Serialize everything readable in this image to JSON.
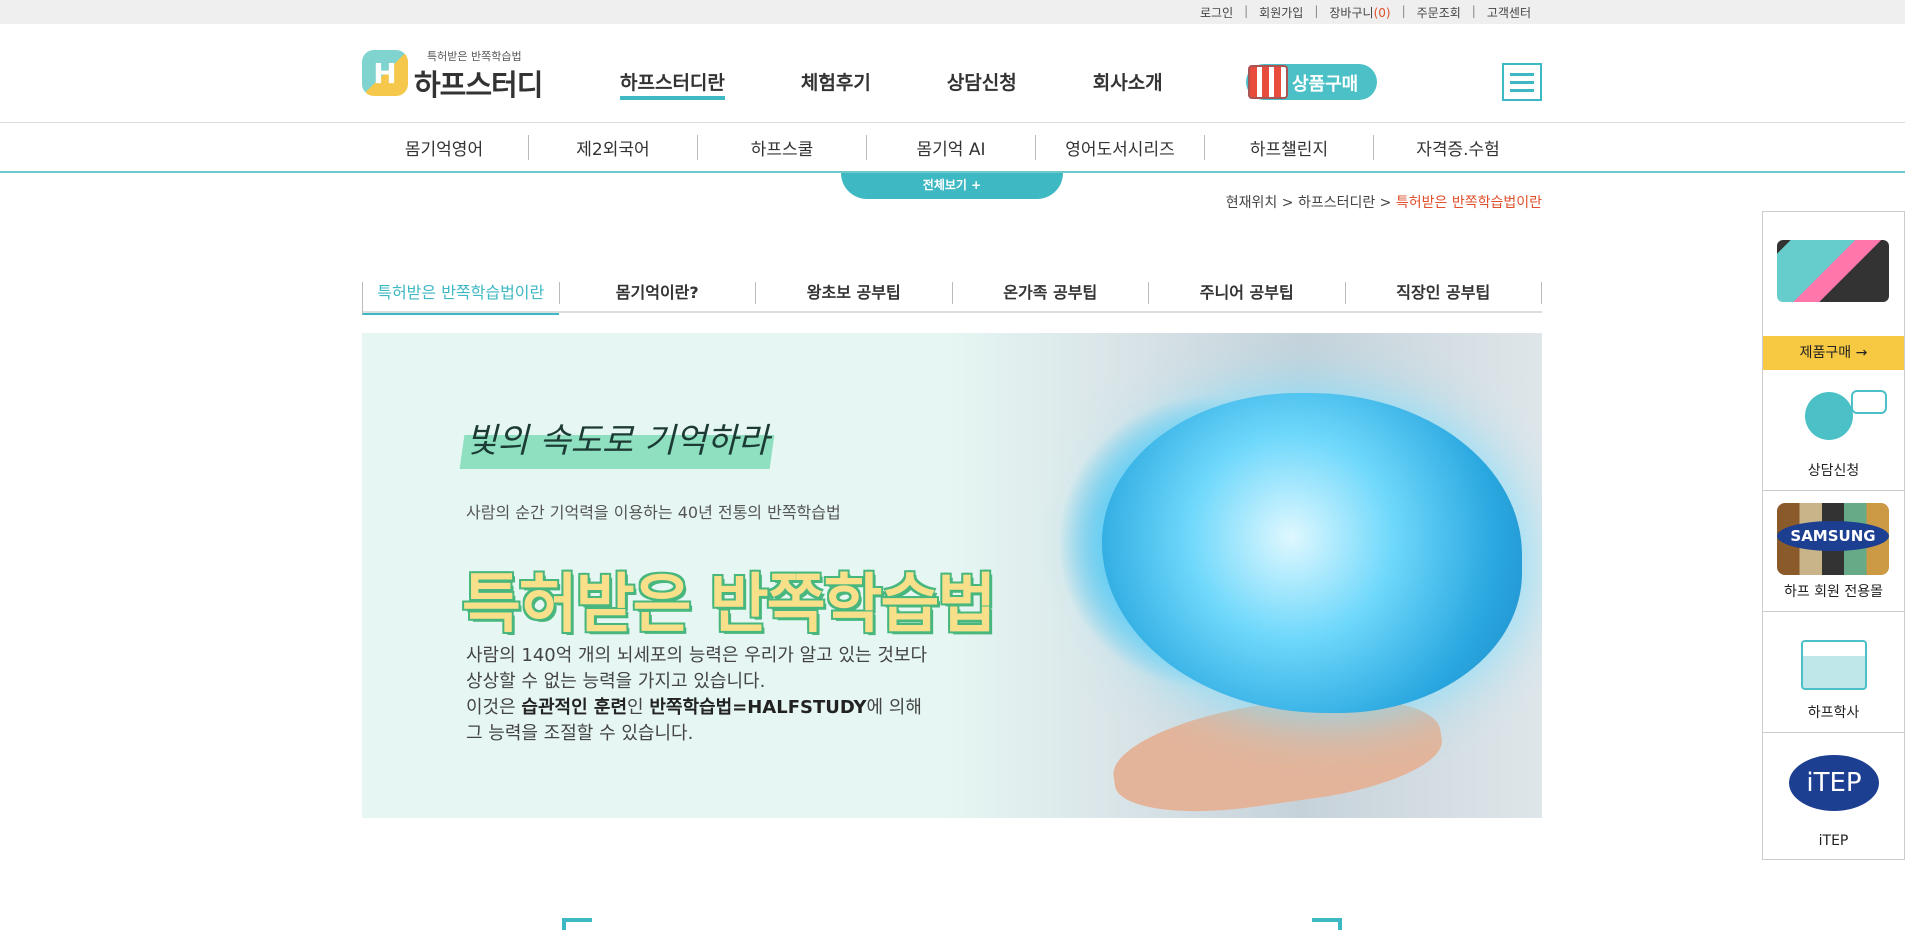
{
  "top_links": {
    "login": "로그인",
    "join": "회원가입",
    "cart": "장바구니",
    "cart_count": "(0)",
    "order": "주문조회",
    "cs": "고객센터"
  },
  "logo": {
    "sub": "특허받은 반쪽학습법",
    "main": "하프스터디"
  },
  "gnb": [
    "하프스터디란",
    "체험후기",
    "상담신청",
    "회사소개"
  ],
  "buy_button": "상품구매",
  "subnav": [
    "몸기억영어",
    "제2외국어",
    "하프스쿨",
    "몸기억 AI",
    "영어도서시리즈",
    "하프챌린지",
    "자격증.수험"
  ],
  "view_all": "전체보기 +",
  "location": {
    "prefix": "현재위치 > 하프스터디란 > ",
    "current": "특허받은 반쪽학습법이란"
  },
  "tabs": [
    "특허받은 반쪽학습법이란",
    "몸기억이란?",
    "왕초보 공부팁",
    "온가족 공부팁",
    "주니어 공부팁",
    "직장인 공부팁"
  ],
  "hero": {
    "script": "빛의 속도로 기억하라",
    "subtitle": "사람의 순간 기억력을 이용하는 40년 전통의 반쪽학습법",
    "title": "특허받은 반쪽학습법",
    "desc_line1": "사람의 140억 개의 뇌세포의 능력은 우리가 알고 있는 것보다",
    "desc_line2": "상상할 수 없는 능력을 가지고 있습니다.",
    "desc_line3_a": "이것은 ",
    "desc_line3_b": "습관적인 훈련",
    "desc_line3_c": "인 ",
    "desc_line3_d": "반쪽학습법=HALFSTUDY",
    "desc_line3_e": "에 의해",
    "desc_line4": "그 능력을 조절할 수 있습니다."
  },
  "side": {
    "buy": "제품구매 →",
    "consult": "상담신청",
    "member": "하프 회원 전용몰",
    "academy": "하프학사",
    "itep": "iTEP",
    "samsung": "SAMSUNG",
    "itep_logo": "iTEP"
  }
}
